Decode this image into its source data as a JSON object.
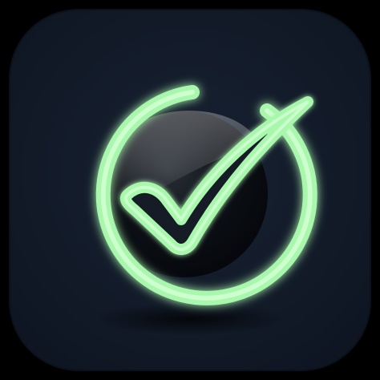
{
  "icon": {
    "name": "checkmark-circle-app-icon",
    "glyph": "check-mark",
    "shape": "rounded-square",
    "colors": {
      "outer_background": "#000000",
      "tile": "#121a27",
      "tile_edge": "#0d1420",
      "glow_green": "#a9f7ad",
      "ring_core": "#d2ffd3",
      "lens_dark": "#05070c",
      "lens_highlight": "#ffffff",
      "shadow": "#000000"
    }
  }
}
